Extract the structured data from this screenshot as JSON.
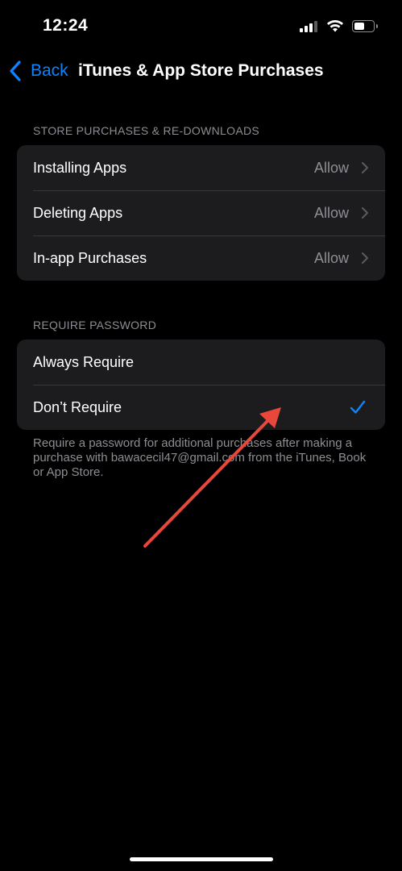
{
  "status_bar": {
    "time": "12:24",
    "icons": [
      "signal-icon",
      "wifi-icon",
      "battery-icon"
    ]
  },
  "nav": {
    "back_label": "Back",
    "title": "iTunes & App Store Purchases"
  },
  "store_section": {
    "header": "STORE PURCHASES & RE-DOWNLOADS",
    "rows": [
      {
        "label": "Installing Apps",
        "value": "Allow"
      },
      {
        "label": "Deleting Apps",
        "value": "Allow"
      },
      {
        "label": "In-app Purchases",
        "value": "Allow"
      }
    ]
  },
  "password_section": {
    "header": "REQUIRE PASSWORD",
    "rows": [
      {
        "label": "Always Require",
        "selected": false
      },
      {
        "label": "Don’t Require",
        "selected": true
      }
    ],
    "footer": "Require a password for additional purchases after making a purchase with bawacecil47@gmail.com from the iTunes, Book or App Store."
  },
  "colors": {
    "accent": "#0a84ff",
    "background": "#000000",
    "cell": "#1c1c1e",
    "secondary_text": "#8d8d93",
    "annotation_arrow": "#e8473b"
  }
}
